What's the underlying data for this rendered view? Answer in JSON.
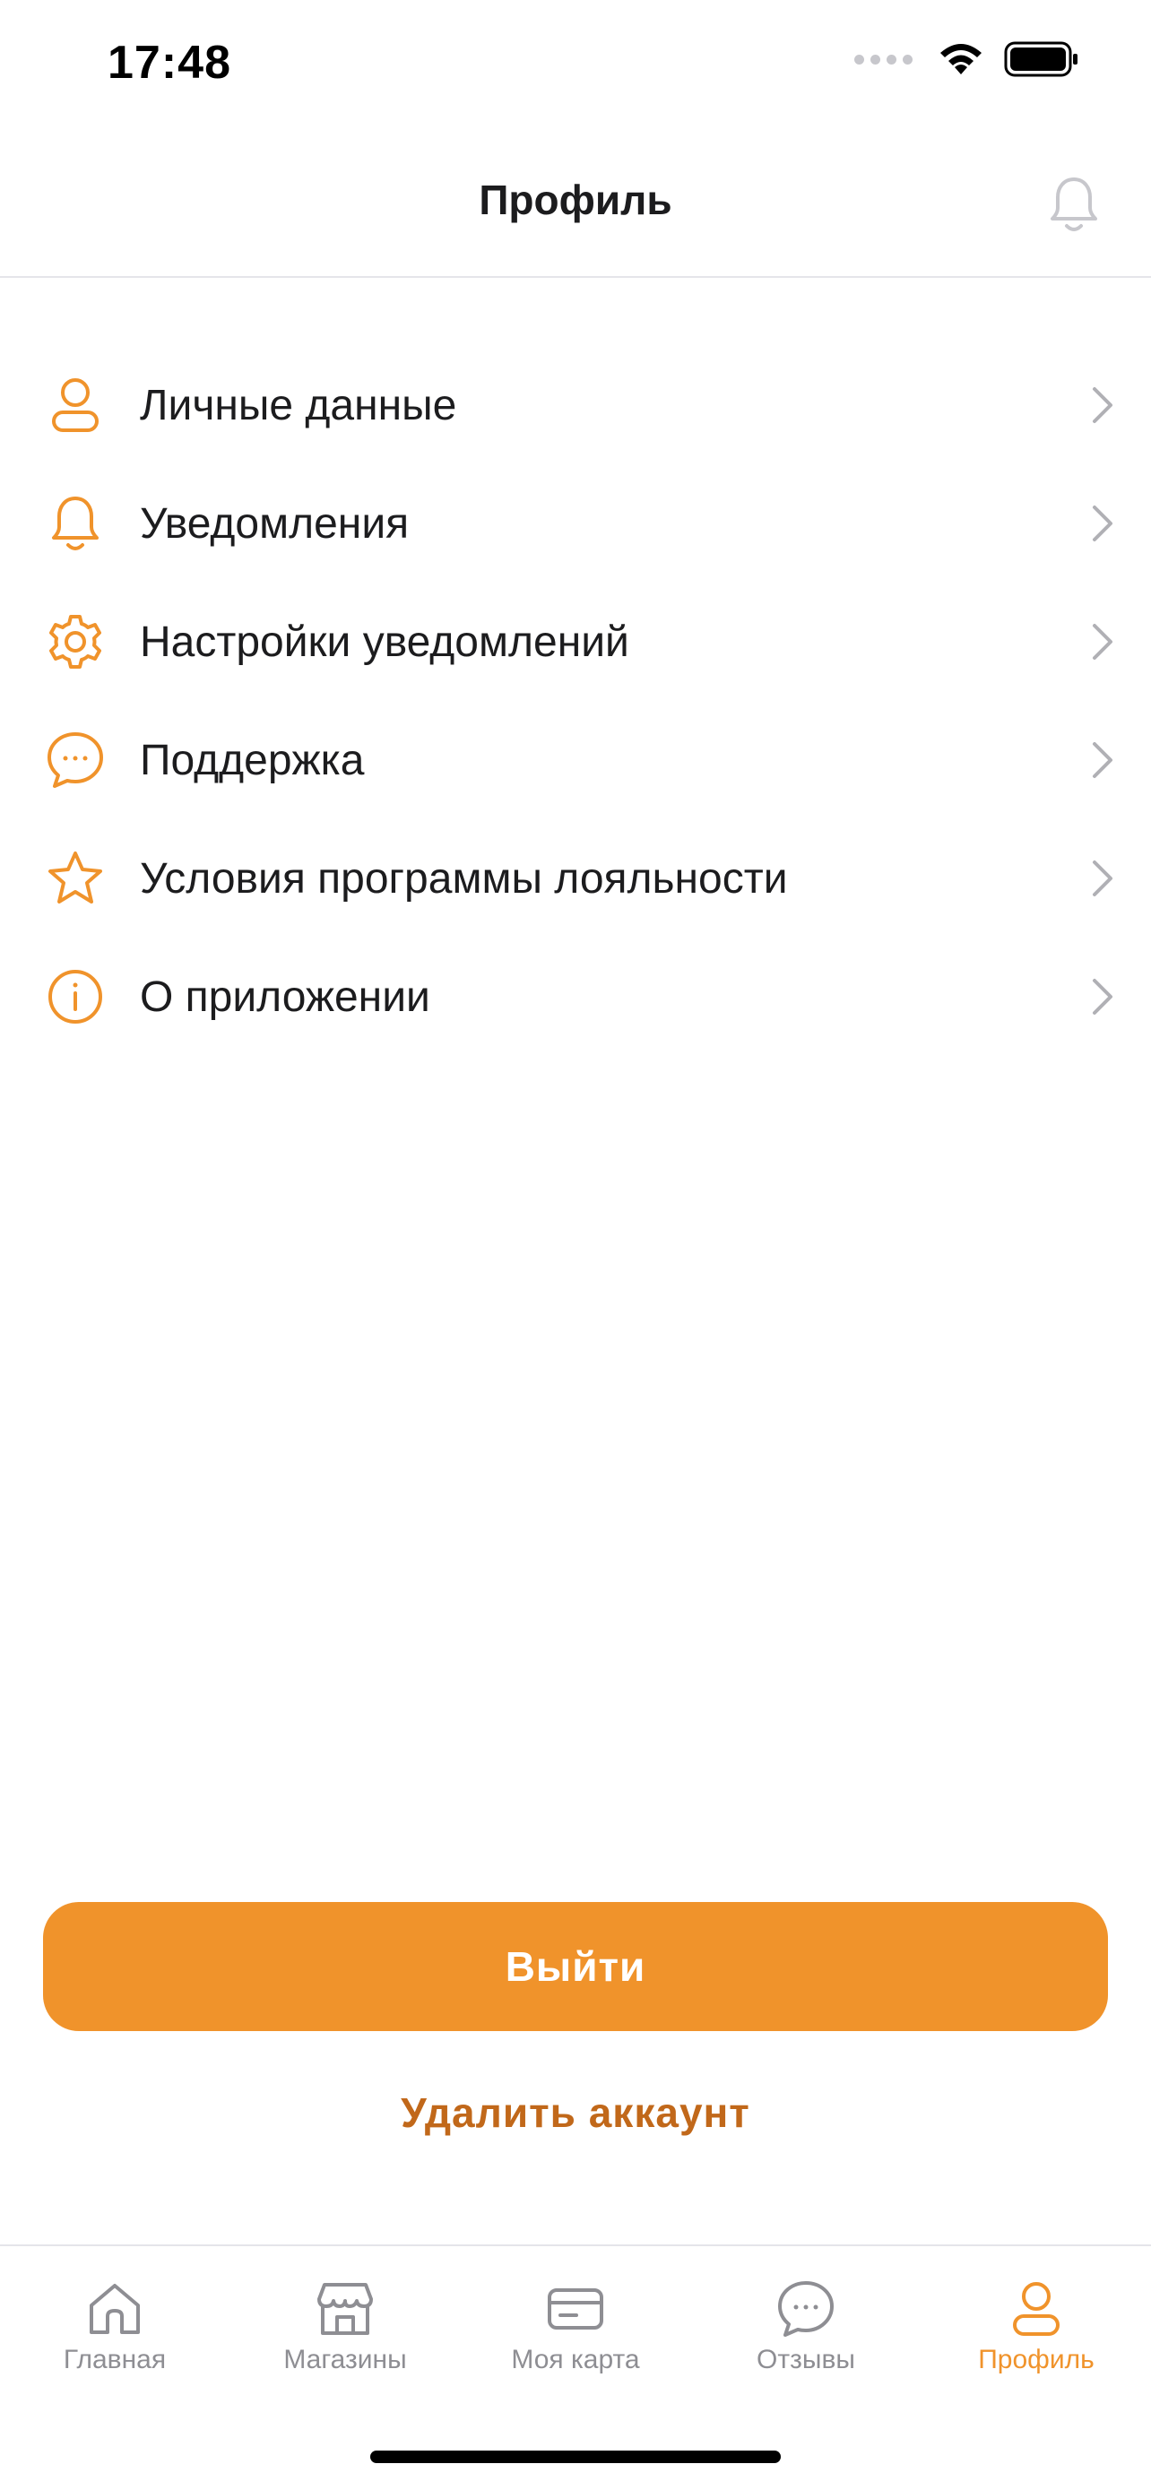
{
  "status_bar": {
    "time": "17:48"
  },
  "header": {
    "title": "Профиль",
    "bell_icon": "bell-icon"
  },
  "menu": {
    "items": [
      {
        "label": "Личные данные",
        "icon": "user-icon"
      },
      {
        "label": "Уведомления",
        "icon": "bell-icon"
      },
      {
        "label": "Настройки уведомлений",
        "icon": "gear-icon"
      },
      {
        "label": "Поддержка",
        "icon": "chat-bubble-icon"
      },
      {
        "label": "Условия программы лояльности",
        "icon": "star-icon"
      },
      {
        "label": "О приложении",
        "icon": "info-icon"
      }
    ]
  },
  "actions": {
    "logout_label": "Выйти",
    "delete_account_label": "Удалить аккаунт"
  },
  "tabbar": {
    "tabs": [
      {
        "label": "Главная",
        "icon": "home-icon",
        "active": false
      },
      {
        "label": "Магазины",
        "icon": "store-icon",
        "active": false
      },
      {
        "label": "Моя карта",
        "icon": "card-icon",
        "active": false
      },
      {
        "label": "Отзывы",
        "icon": "chat-bubble-icon",
        "active": false
      },
      {
        "label": "Профиль",
        "icon": "user-icon",
        "active": true
      }
    ]
  },
  "colors": {
    "accent": "#f0932b",
    "danger_text": "#c1681a",
    "inactive": "#8e8e93",
    "divider": "#e5e5ea"
  }
}
